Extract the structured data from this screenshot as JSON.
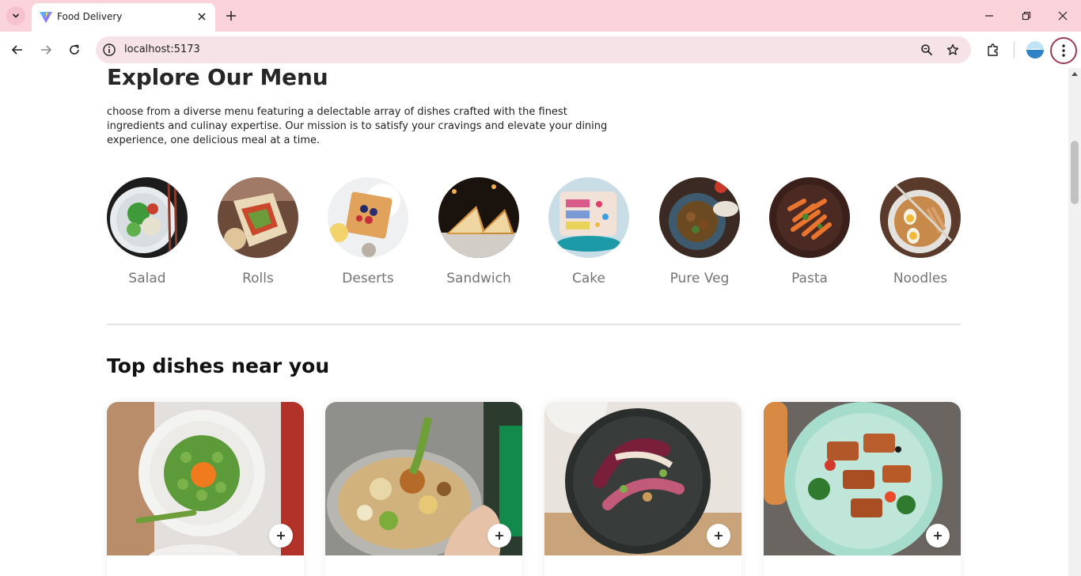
{
  "browser": {
    "tab_title": "Food Delivery",
    "url": "localhost:5173"
  },
  "menu": {
    "title": "Explore Our Menu",
    "description": "choose from a diverse menu featuring a delectable array of dishes crafted with the finest ingredients and culinay expertise. Our mission is to satisfy your cravings and elevate your dining experience, one delicious meal at a time.",
    "categories": [
      {
        "label": "Salad",
        "icon": "salad-image"
      },
      {
        "label": "Rolls",
        "icon": "rolls-image"
      },
      {
        "label": "Deserts",
        "icon": "deserts-image"
      },
      {
        "label": "Sandwich",
        "icon": "sandwich-image"
      },
      {
        "label": "Cake",
        "icon": "cake-image"
      },
      {
        "label": "Pure Veg",
        "icon": "pure-veg-image"
      },
      {
        "label": "Pasta",
        "icon": "pasta-image"
      },
      {
        "label": "Noodles",
        "icon": "noodles-image"
      }
    ]
  },
  "dishes": {
    "title": "Top dishes near you",
    "add_label": "+"
  }
}
